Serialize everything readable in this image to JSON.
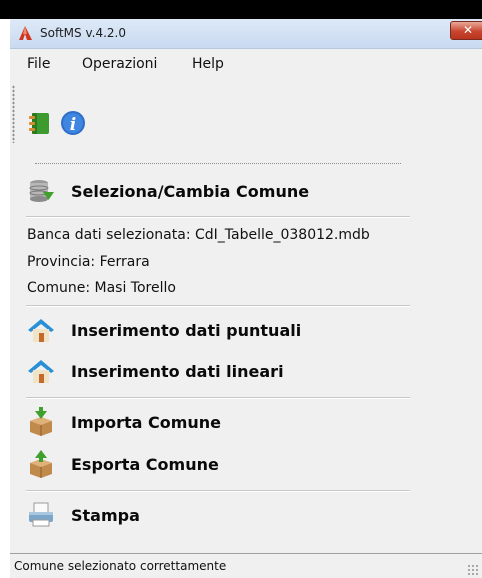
{
  "window": {
    "title": "SoftMS v.4.2.0",
    "close_label": "✕"
  },
  "menu": {
    "items": [
      "File",
      "Operazioni",
      "Help"
    ]
  },
  "toolbar": {
    "icons": [
      "book-icon",
      "info-icon"
    ]
  },
  "selection": {
    "label": "Seleziona/Cambia Comune",
    "icon": "database-select-icon"
  },
  "info": {
    "database": "Banca dati selezionata: CdI_Tabelle_038012.mdb",
    "province": "Provincia: Ferrara",
    "municipality": "Comune: Masi Torello"
  },
  "actions": {
    "point_data": "Inserimento dati puntuali",
    "linear_data": "Inserimento dati lineari",
    "import": "Importa Comune",
    "export": "Esporta Comune",
    "print": "Stampa"
  },
  "status": {
    "text": "Comune selezionato correttamente"
  },
  "colors": {
    "window_bg": "#f0f0f0",
    "title_bg": "#dde9f7",
    "close_red": "#c8452f"
  }
}
